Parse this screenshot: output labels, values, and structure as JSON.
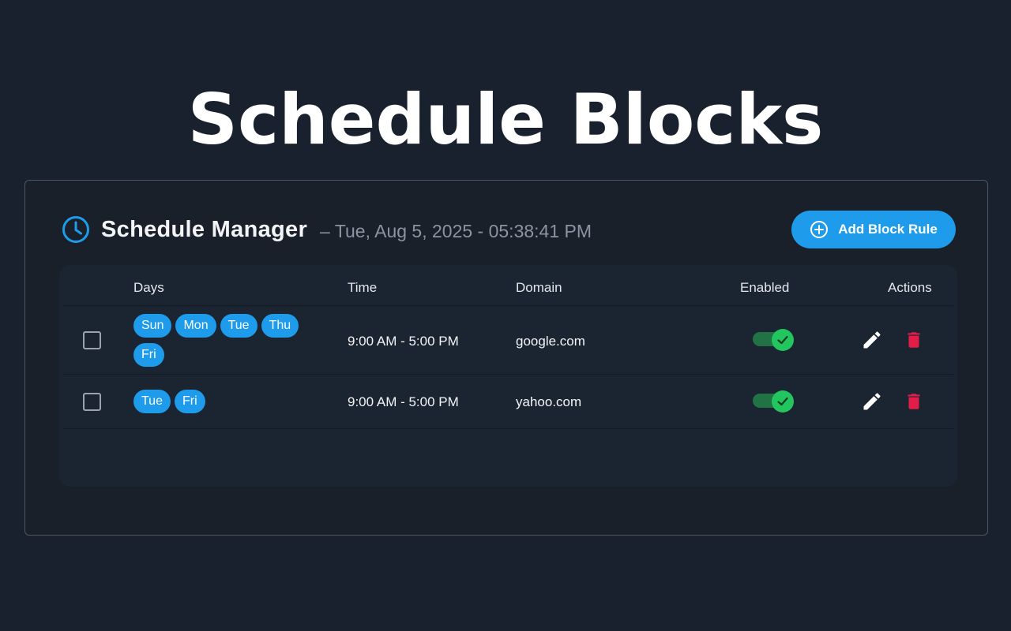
{
  "hero": {
    "title": "Schedule Blocks"
  },
  "header": {
    "title": "Schedule Manager",
    "datetime": "– Tue, Aug 5, 2025 - 05:38:41 PM",
    "add_button_label": "Add Block Rule"
  },
  "table": {
    "columns": {
      "days": "Days",
      "time": "Time",
      "domain": "Domain",
      "enabled": "Enabled",
      "actions": "Actions"
    },
    "rows": [
      {
        "days": [
          "Sun",
          "Mon",
          "Tue",
          "Thu",
          "Fri"
        ],
        "time": "9:00 AM - 5:00 PM",
        "domain": "google.com",
        "enabled": true,
        "selected": false
      },
      {
        "days": [
          "Tue",
          "Fri"
        ],
        "time": "9:00 AM - 5:00 PM",
        "domain": "yahoo.com",
        "enabled": true,
        "selected": false
      }
    ]
  },
  "colors": {
    "background": "#18212d",
    "accent": "#1e9bea",
    "toggle_on": "#22c55e",
    "delete": "#e11d48"
  },
  "icons": {
    "header": "clock-icon",
    "add": "plus-circle-icon",
    "edit": "pencil-icon",
    "delete": "trash-icon",
    "toggle": "check-icon"
  }
}
